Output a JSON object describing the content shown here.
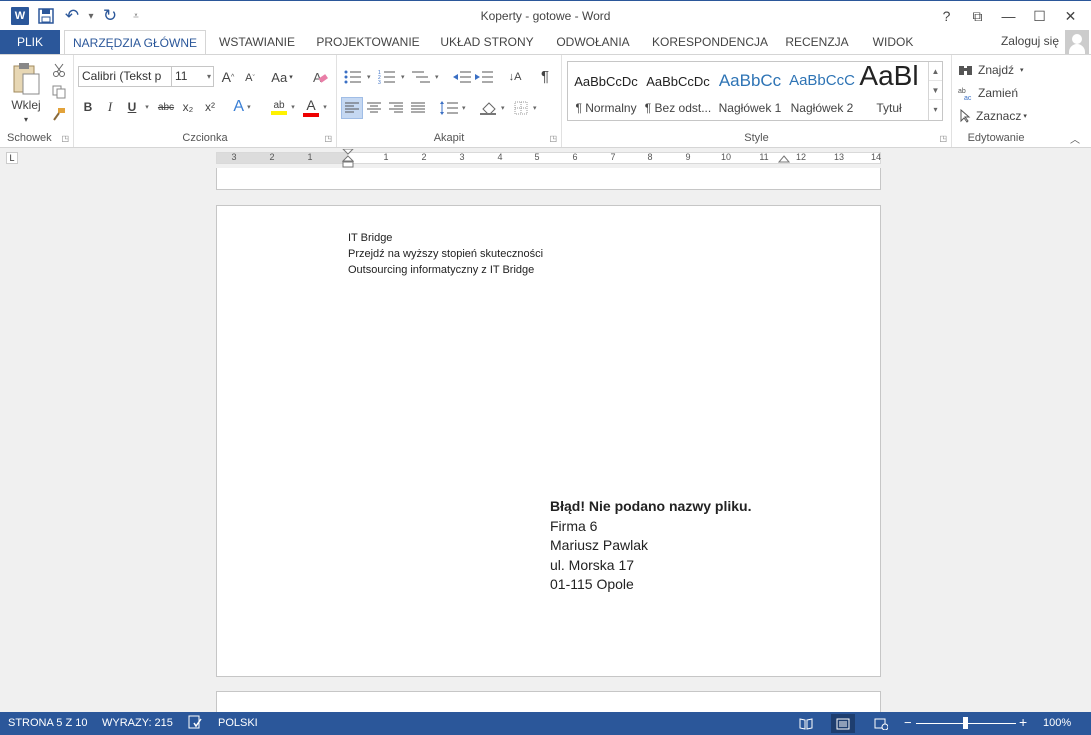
{
  "window": {
    "title": "Koperty - gotowe - Word",
    "help": "?",
    "ribbon_display": "⧉",
    "minimize": "—",
    "maximize": "☐",
    "close": "✕"
  },
  "qat": {
    "logo": "W",
    "save": "💾",
    "undo": "↶",
    "undo_drop": "▾",
    "redo": "↻",
    "customize": "⩡"
  },
  "tabs": {
    "file": "PLIK",
    "home": "NARZĘDZIA GŁÓWNE",
    "insert": "WSTAWIANIE",
    "design": "PROJEKTOWANIE",
    "layout": "UKŁAD STRONY",
    "references": "ODWOŁANIA",
    "mailings": "KORESPONDENCJA",
    "review": "RECENZJA",
    "view": "WIDOK",
    "login": "Zaloguj się"
  },
  "ribbon": {
    "clipboard": {
      "label": "Schowek",
      "paste": "Wklej",
      "paste_arrow": "▾"
    },
    "font": {
      "label": "Czcionka",
      "font_name": "Calibri (Tekst p",
      "font_size": "11",
      "grow": "A",
      "shrink": "A",
      "change_case": "Aa",
      "bold": "B",
      "italic": "I",
      "underline": "U",
      "strike": "abc",
      "subscript": "x₂",
      "superscript": "x²",
      "text_effects": "A",
      "highlight": "ab",
      "font_color": "A"
    },
    "paragraph": {
      "label": "Akapit",
      "pilcrow": "¶",
      "sort": "↓A"
    },
    "styles": {
      "label": "Style",
      "items": [
        {
          "preview": "AaBbCcDc",
          "name": "¶ Normalny"
        },
        {
          "preview": "AaBbCcDc",
          "name": "¶ Bez odst..."
        },
        {
          "preview": "AaBbCc",
          "name": "Nagłówek 1"
        },
        {
          "preview": "AaBbCcC",
          "name": "Nagłówek 2"
        },
        {
          "preview": "AaBl",
          "name": "Tytuł"
        }
      ]
    },
    "editing": {
      "label": "Edytowanie",
      "find": "Znajdź",
      "replace": "Zamień",
      "select": "Zaznacz"
    }
  },
  "ruler": {
    "tab_selector": "L",
    "left_numbers": [
      "3",
      "2",
      "1"
    ],
    "right_numbers": [
      "1",
      "2",
      "3",
      "4",
      "5",
      "6",
      "7",
      "8",
      "9",
      "10",
      "11",
      "12",
      "13",
      "14"
    ]
  },
  "document": {
    "sender": [
      "IT Bridge",
      "Przejdź na wyższy stopień skuteczności",
      "Outsourcing informatyczny z IT Bridge"
    ],
    "recipient_error": "Błąd! Nie podano nazwy pliku.",
    "recipient_lines": [
      "Firma 6",
      "Mariusz Pawlak",
      "ul. Morska 17",
      "01-115 Opole"
    ]
  },
  "status": {
    "page": "STRONA 5 Z 10",
    "words": "WYRAZY: 215",
    "language": "POLSKI",
    "zoom_minus": "−",
    "zoom_plus": "+",
    "zoom": "100%",
    "zoom_level": 0.5
  }
}
